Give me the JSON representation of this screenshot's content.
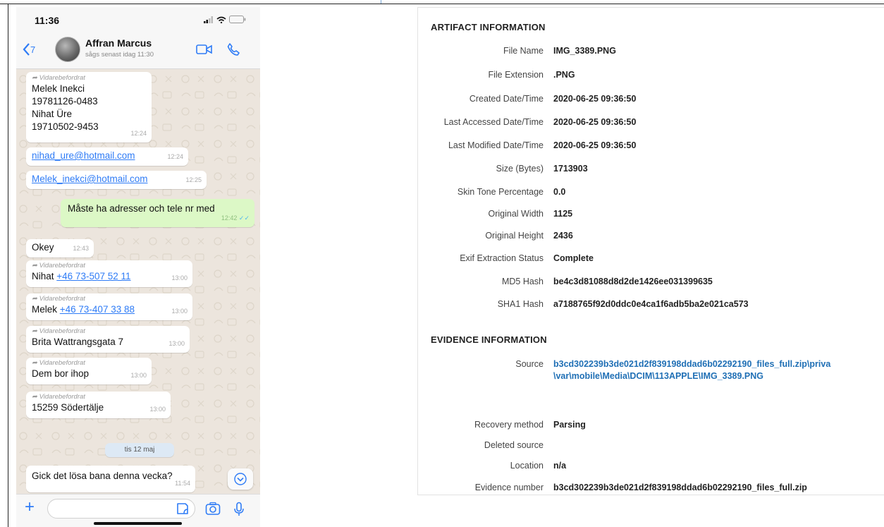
{
  "phone": {
    "status_time": "11:36",
    "back_count": "7",
    "contact_name": "Affran Marcus",
    "contact_seen": "sågs senast idag 11:30",
    "messages": [
      {
        "forwarded_label": "Vidarebefordrat",
        "line1": "Melek Inekci",
        "line2": "19781126-0483",
        "line3": "Nihat Üre",
        "line4": "19710502-9453",
        "time": "12:24"
      },
      {
        "link": "nihad_ure@hotmail.com",
        "time": "12:24"
      },
      {
        "link": "Melek_inekci@hotmail.com",
        "time": "12:25"
      },
      {
        "text": "Måste ha adresser och tele nr med",
        "time": "12:42"
      },
      {
        "text": "Okey",
        "time": "12:43"
      },
      {
        "forwarded_label": "Vidarebefordrat",
        "prefix": "Nihat ",
        "link": "+46 73-507 52 11",
        "time": "13:00"
      },
      {
        "forwarded_label": "Vidarebefordrat",
        "prefix": "Melek ",
        "link": "+46 73-407 33 88",
        "time": "13:00"
      },
      {
        "forwarded_label": "Vidarebefordrat",
        "text": "Brita Wattrangsgata 7",
        "time": "13:00"
      },
      {
        "forwarded_label": "Vidarebefordrat",
        "text": "Dem bor ihop",
        "time": "13:00"
      },
      {
        "forwarded_label": "Vidarebefordrat",
        "text": "15259 Södertälje",
        "time": "13:00"
      },
      {
        "text": "Gick det lösa bana denna vecka?",
        "time": "11:54"
      }
    ],
    "day_chip": "tis 12 maj",
    "colors": {
      "accent": "#2f7cf6",
      "outgoing": "#dcf8c6",
      "incoming": "#ffffff",
      "background": "#ece5dd"
    }
  },
  "artifact": {
    "title": "ARTIFACT INFORMATION",
    "rows": [
      {
        "label": "File Name",
        "value": "IMG_3389.PNG"
      },
      {
        "label": "File Extension",
        "value": ".PNG"
      },
      {
        "label": "Created Date/Time",
        "value": "2020-06-25 09:36:50"
      },
      {
        "label": "Last Accessed Date/Time",
        "value": "2020-06-25 09:36:50"
      },
      {
        "label": "Last Modified Date/Time",
        "value": "2020-06-25 09:36:50"
      },
      {
        "label": "Size (Bytes)",
        "value": "1713903"
      },
      {
        "label": "Skin Tone Percentage",
        "value": "0.0"
      },
      {
        "label": "Original Width",
        "value": "1125"
      },
      {
        "label": "Original Height",
        "value": "2436"
      },
      {
        "label": "Exif Extraction Status",
        "value": "Complete"
      },
      {
        "label": "MD5 Hash",
        "value": "be4c3d81088d8d2de1426ee031399635"
      },
      {
        "label": "SHA1 Hash",
        "value": "a7188765f92d0ddc0e4ca1f6adb5ba2e021ca573"
      }
    ]
  },
  "evidence": {
    "title": "EVIDENCE INFORMATION",
    "source_label": "Source",
    "source_line1": "b3cd302239b3de021d2f839198ddad6b02292190_files_full.zip\\priva",
    "source_line2": "\\var\\mobile\\Media\\DCIM\\113APPLE\\IMG_3389.PNG",
    "rows": [
      {
        "label": "Recovery method",
        "value": "Parsing"
      },
      {
        "label": "Deleted source",
        "value": ""
      },
      {
        "label": "Location",
        "value": "n/a"
      },
      {
        "label": "Evidence number",
        "value": "b3cd302239b3de021d2f839198ddad6b02292190_files_full.zip"
      }
    ]
  }
}
